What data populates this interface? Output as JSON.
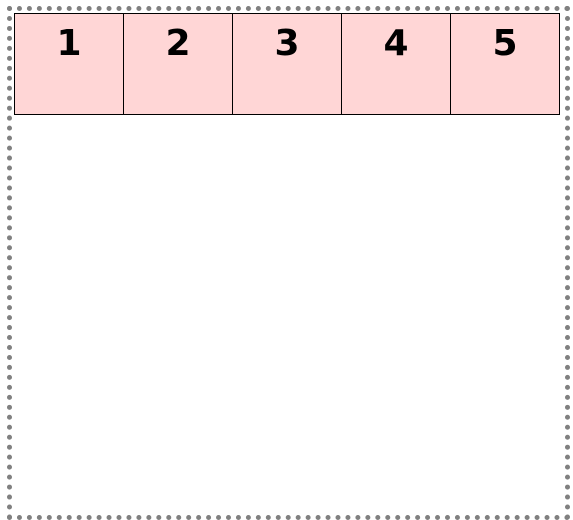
{
  "boxes": [
    {
      "label": "1"
    },
    {
      "label": "2"
    },
    {
      "label": "3"
    },
    {
      "label": "4"
    },
    {
      "label": "5"
    }
  ],
  "colors": {
    "box_fill": "#ffd6d6",
    "box_border": "#000000",
    "container_border": "#808080"
  }
}
